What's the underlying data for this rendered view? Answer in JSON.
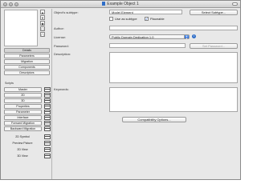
{
  "window": {
    "title": "Example Object 1",
    "doc_icon": "document-icon"
  },
  "left": {
    "tools": [
      "▲",
      "▼",
      "◆",
      "☐",
      "▢"
    ],
    "sections": [
      "Details",
      "Parameters",
      "Migration",
      "Components",
      "Descriptors"
    ],
    "active_section": "Details",
    "scripts_label": "Scripts",
    "scripts": [
      "Master",
      "2D",
      "3D",
      "Properties",
      "Parameter",
      "Interface",
      "Forward Migration",
      "Backward Migration"
    ],
    "views": [
      "2D Symbol",
      "Preview Picture",
      "2D View",
      "3D View"
    ]
  },
  "details": {
    "subtype_label": "Object's subtype:",
    "subtype_value": "Model Element",
    "select_subtype_label": "Select Subtype...",
    "use_as_subtype_label": "Use as subtype",
    "use_as_subtype_checked": false,
    "placeable_label": "Placeable",
    "placeable_checked": true,
    "author_label": "Author:",
    "author_value": "",
    "license_label": "License:",
    "license_value": "Public Domain Dedication 1.0",
    "info_glyph": "i",
    "password_label": "Password:",
    "password_value": "",
    "set_password_label": "Set Password...",
    "description_label": "Description:",
    "description_value": "",
    "keywords_label": "Keywords:",
    "keywords_value": "",
    "compat_label": "Compatibility Options..."
  }
}
